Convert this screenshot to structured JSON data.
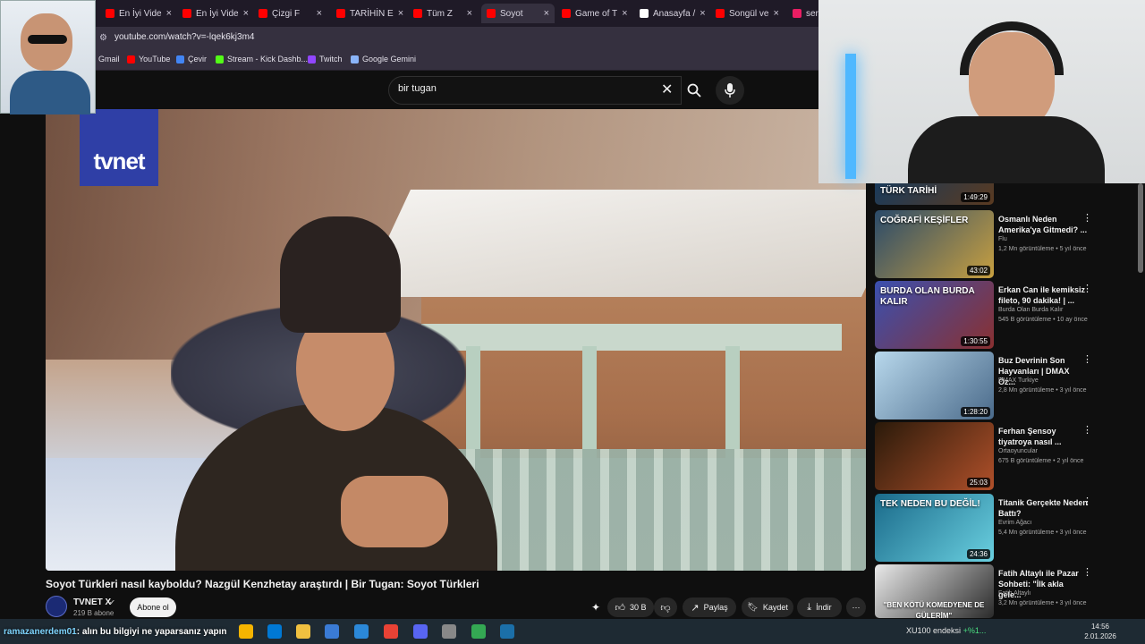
{
  "browser": {
    "tabs": [
      {
        "label": "En İyi Vide",
        "color": "#ff0000"
      },
      {
        "label": "En İyi Vide",
        "color": "#ff0000"
      },
      {
        "label": "Çizgi F",
        "color": "#ff0000"
      },
      {
        "label": "TARİHİN E",
        "color": "#ff0000"
      },
      {
        "label": "Tüm Z",
        "color": "#ff0000"
      },
      {
        "label": "Soyot",
        "color": "#ff0000",
        "active": true
      },
      {
        "label": "Game of T",
        "color": "#ff0000"
      },
      {
        "label": "Anasayfa /",
        "color": "#ffffff"
      },
      {
        "label": "Songül ve",
        "color": "#ff0000"
      },
      {
        "label": "serh",
        "color": "#e91e63"
      }
    ],
    "url": "youtube.com/watch?v=-lqek6kj3m4",
    "bookmarks": [
      {
        "label": "Gmail",
        "color": "#ea4335"
      },
      {
        "label": "YouTube",
        "color": "#ff0000"
      },
      {
        "label": "Çevir",
        "color": "#4285f4"
      },
      {
        "label": "Stream - Kick Dashb...",
        "color": "#53fc18"
      },
      {
        "label": "Twitch",
        "color": "#9146ff"
      },
      {
        "label": "Google Gemini",
        "color": "#8ab4f8"
      }
    ]
  },
  "search": {
    "query": "bir tugan",
    "clear_glyph": "✕"
  },
  "video": {
    "logo_text": "tvnet",
    "title": "Soyot Türkleri nasıl kayboldu? Nazgül Kenzhetay araştırdı | Bir Tugan: Soyot Türkleri",
    "channel": "TVNET X",
    "subscribers": "219 B abone",
    "subscribe_label": "Abone ol",
    "likes": "30 B",
    "share_label": "Paylaş",
    "save_label": "Kaydet",
    "download_label": "İndir"
  },
  "recommendations": [
    {
      "title": "",
      "channel": "",
      "meta": "",
      "duration": "1:49:29",
      "thumb_text": "TÜRK TARİHİ",
      "colors": [
        "#1a3a5a",
        "#5a3a20"
      ]
    },
    {
      "title": "Osmanlı Neden Amerika'ya Gitmedi? ...",
      "channel": "Flu",
      "meta": "1,2 Mn görüntüleme • 5 yıl önce",
      "duration": "43:02",
      "thumb_text": "COĞRAFİ KEŞİFLER",
      "colors": [
        "#2a4a6a",
        "#c8a040"
      ]
    },
    {
      "title": "Erkan Can ile kemiksiz fileto, 90 dakika! | ...",
      "channel": "Burda Olan Burda Kalır",
      "meta": "545 B görüntüleme • 10 ay önce",
      "duration": "1:30:55",
      "thumb_text": "BURDA OLAN BURDA KALIR",
      "colors": [
        "#3a50b0",
        "#8a3030"
      ]
    },
    {
      "title": "Buz Devrinin Son Hayvanları | DMAX Öz...",
      "channel": "DMAX Turkiye",
      "meta": "2,8 Mn görüntüleme • 3 yıl önce",
      "duration": "1:28:20",
      "thumb_text": "",
      "colors": [
        "#b8d8ec",
        "#4a6a8a"
      ]
    },
    {
      "title": "Ferhan Şensoy tiyatroya nasıl ...",
      "channel": "Ortaoyuncular",
      "meta": "675 B görüntüleme • 2 yıl önce",
      "duration": "25:03",
      "thumb_text": "",
      "colors": [
        "#2a1a0a",
        "#b0502a"
      ]
    },
    {
      "title": "Titanik Gerçekte Neden Battı?",
      "channel": "Evrim Ağacı",
      "meta": "5,4 Mn görüntüleme • 3 yıl önce",
      "duration": "24:36",
      "thumb_text": "TEK NEDEN BU DEĞİL!",
      "colors": [
        "#1a6a8a",
        "#6ad0e0"
      ]
    },
    {
      "title": "Fatih Altaylı ile Pazar Sohbeti: \"İlk akla gele...",
      "channel": "Fatih Altaylı",
      "meta": "3,2 Mn görüntüleme • 3 yıl önce",
      "duration": "",
      "thumb_text": "\"BEN KÖTÜ KOMEDYENE DE GÜLERİM\"",
      "colors": [
        "#eaeaea",
        "#2a2a2a"
      ]
    }
  ],
  "taskbar": {
    "chat_user": "ramazanerdem01",
    "chat_message": ": alın bu bilgiyi ne yaparsanız yapın",
    "stock_label": "XU100 endeksi",
    "stock_change": "+%1...",
    "time": "14:56",
    "date": "2.01.2026"
  }
}
